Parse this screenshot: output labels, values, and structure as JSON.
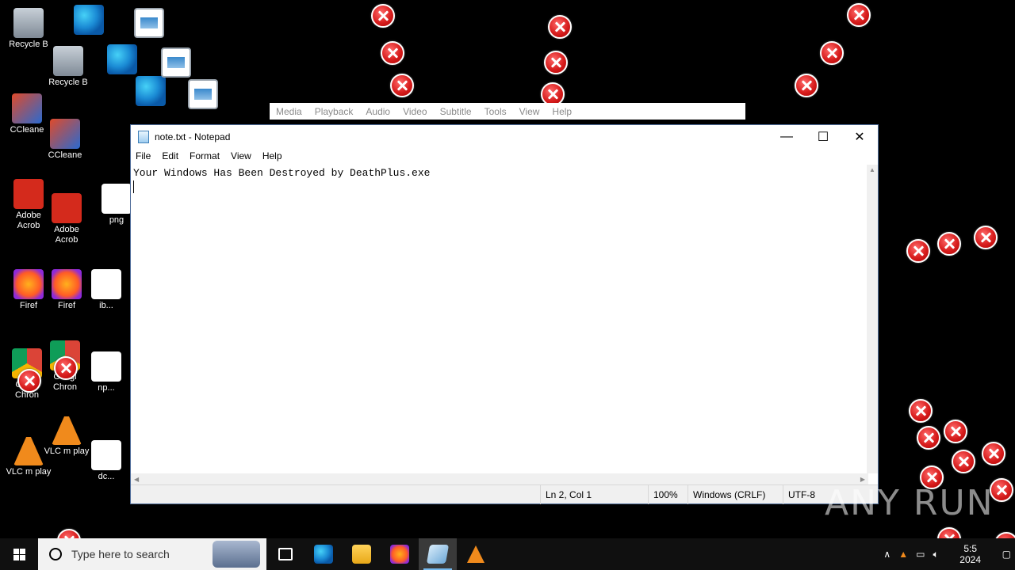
{
  "desktop": {
    "icons": [
      {
        "label": "Recycle B"
      },
      {
        "label": "Recycle B"
      },
      {
        "label": "CCleane"
      },
      {
        "label": "CCleane"
      },
      {
        "label": "Adobe Acrob"
      },
      {
        "label": "Adobe Acrob"
      },
      {
        "label": "Firef"
      },
      {
        "label": "Firef"
      },
      {
        "label": "Googl Chron"
      },
      {
        "label": "Googl Chron"
      },
      {
        "label": "VLC m play"
      },
      {
        "label": "VLC m play"
      },
      {
        "label": "png"
      },
      {
        "label": "ib..."
      },
      {
        "label": "np..."
      },
      {
        "label": "dc..."
      }
    ]
  },
  "vlc_menu": [
    "Media",
    "Playback",
    "Audio",
    "Video",
    "Subtitle",
    "Tools",
    "View",
    "Help"
  ],
  "notepad": {
    "title": "note.txt - Notepad",
    "menu": [
      "File",
      "Edit",
      "Format",
      "View",
      "Help"
    ],
    "content_line1": "Your Windows Has Been Destroyed by DeathPlus.exe",
    "status": {
      "position": "Ln 2, Col 1",
      "zoom": "100%",
      "line_endings": "Windows (CRLF)",
      "encoding": "UTF-8"
    },
    "caption_buttons": {
      "minimize": "—",
      "maximize": "☐",
      "close": "✕"
    }
  },
  "taskbar": {
    "search_placeholder": "Type here to search",
    "apps": [
      "task-view",
      "edge",
      "file-explorer",
      "firefox",
      "notepad",
      "vlc"
    ],
    "active_app": "notepad",
    "clock_time": "5:5",
    "clock_date": "2024"
  },
  "watermark": "ANY RUN",
  "colors": {
    "error_red": "#d81e1e",
    "taskbar": "#101010",
    "active_indicator": "#76b9ed"
  }
}
